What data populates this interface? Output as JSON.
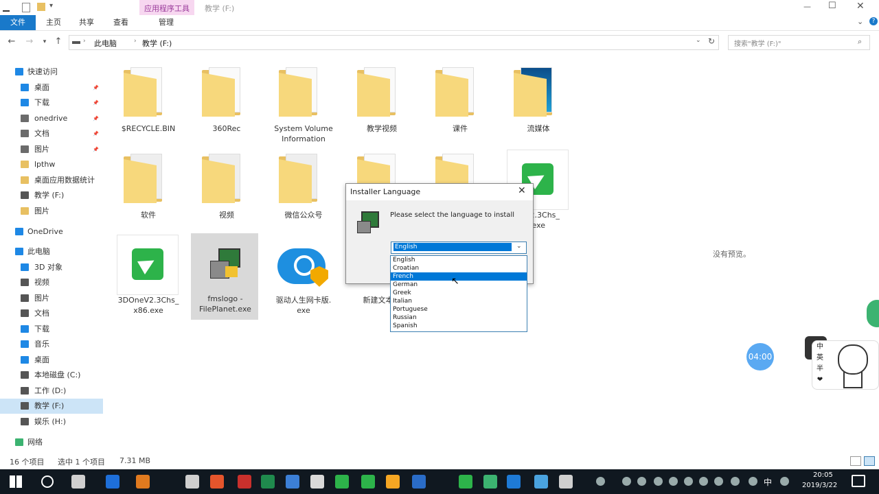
{
  "titlebar": {
    "app_tools": "应用程序工具",
    "path_title": "教学 (F:)"
  },
  "ribbon": {
    "tabs": [
      "文件",
      "主页",
      "共享",
      "查看",
      "管理"
    ]
  },
  "nav": {
    "breadcrumb": [
      "此电脑",
      "教学 (F:)"
    ],
    "search_placeholder": "搜索\"教学 (F:)\""
  },
  "sidebar": {
    "quick_access": "快速访问",
    "quick_items": [
      {
        "label": "桌面",
        "color": "#1e88e5"
      },
      {
        "label": "下载",
        "color": "#1e88e5"
      },
      {
        "label": "onedrive",
        "color": "#6b6b6b"
      },
      {
        "label": "文档",
        "color": "#6b6b6b"
      },
      {
        "label": "图片",
        "color": "#6b6b6b"
      },
      {
        "label": "lpthw",
        "color": "#e8c062"
      },
      {
        "label": "桌面应用数据统计",
        "color": "#e8c062"
      },
      {
        "label": "教学 (F:)",
        "color": "#555555"
      },
      {
        "label": "图片",
        "color": "#e8c062"
      }
    ],
    "onedrive": "OneDrive",
    "this_pc": "此电脑",
    "pc_items": [
      {
        "label": "3D 对象",
        "color": "#1e88e5"
      },
      {
        "label": "视频",
        "color": "#555555"
      },
      {
        "label": "图片",
        "color": "#555555"
      },
      {
        "label": "文档",
        "color": "#555555"
      },
      {
        "label": "下载",
        "color": "#1e88e5"
      },
      {
        "label": "音乐",
        "color": "#1e88e5"
      },
      {
        "label": "桌面",
        "color": "#1e88e5"
      },
      {
        "label": "本地磁盘 (C:)",
        "color": "#555555"
      },
      {
        "label": "工作 (D:)",
        "color": "#555555"
      },
      {
        "label": "教学 (F:)",
        "color": "#555555"
      },
      {
        "label": "娱乐 (H:)",
        "color": "#555555"
      }
    ],
    "network": "网络"
  },
  "files": [
    {
      "label": "$RECYCLE.BIN",
      "type": "folder"
    },
    {
      "label": "360Rec",
      "type": "folder"
    },
    {
      "label": "System Volume Information",
      "type": "folder"
    },
    {
      "label": "教学视频",
      "type": "folder"
    },
    {
      "label": "课件",
      "type": "folder"
    },
    {
      "label": "流媒体",
      "type": "folder"
    },
    {
      "label": "软件",
      "type": "folder"
    },
    {
      "label": "视频",
      "type": "folder"
    },
    {
      "label": "微信公众号",
      "type": "folder"
    },
    {
      "label": "",
      "type": "folder"
    },
    {
      "label": "",
      "type": "folder"
    },
    {
      "label": "V2.3Chs_\n4.exe",
      "type": "exe-green"
    },
    {
      "label": "3DOneV2.3Chs_\nx86.exe",
      "type": "exe-green"
    },
    {
      "label": "fmslogo -\nFilePlanet.exe",
      "type": "exe-setup"
    },
    {
      "label": "驱动人生网卡版.\nexe",
      "type": "exe-blue"
    },
    {
      "label": "新建文本文",
      "type": "text"
    }
  ],
  "preview_text": "没有预览。",
  "status": {
    "count": "16 个项目",
    "selected": "选中 1 个项目",
    "size": "7.31 MB"
  },
  "dialog": {
    "title": "Installer Language",
    "prompt": "Please select the language to install",
    "selected": "English",
    "options": [
      "English",
      "Croatian",
      "French",
      "German",
      "Greek",
      "Italian",
      "Portuguese",
      "Russian",
      "Spanish"
    ],
    "highlighted": "French"
  },
  "overlay": {
    "timer": "04:00",
    "badge_chars": [
      "中",
      "英",
      "半",
      "❤"
    ]
  },
  "taskbar": {
    "time": "20:05",
    "date": "2019/3/22",
    "ime": "中"
  }
}
